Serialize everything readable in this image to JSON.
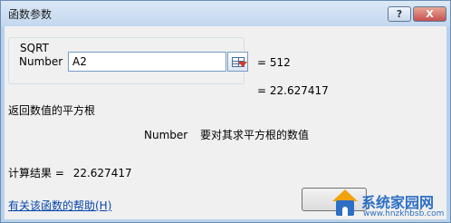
{
  "window": {
    "title": "函数参数",
    "help_button": "?",
    "close_button": "X"
  },
  "function_group": {
    "name": "SQRT",
    "argument_label": "Number",
    "argument_value": "A2",
    "argument_result": "=   512"
  },
  "formula_result": "=   22.627417",
  "description": "返回数值的平方根",
  "parameter_help": {
    "name": "Number",
    "text": "要对其求平方根的数值"
  },
  "calculation": {
    "label": "计算结果 =",
    "value": "22.627417"
  },
  "help_link": "有关该函数的帮助(H)",
  "watermark": {
    "title": "系统家园网",
    "url": "www.hnzkhbsb.com"
  }
}
